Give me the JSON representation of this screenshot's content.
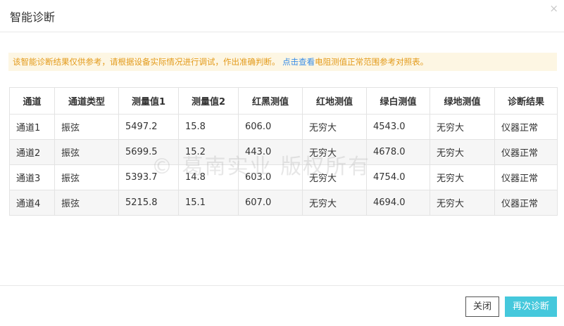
{
  "dialog": {
    "title": "智能诊断",
    "close_glyph": "×"
  },
  "notice": {
    "text": "该智能诊断结果仅供参考，请根据设备实际情况进行调试，作出准确判断。",
    "link_text": "点击查看",
    "link_rest": "电阻测值正常范围参考对照表。"
  },
  "table": {
    "headers": [
      "通道",
      "通道类型",
      "测量值1",
      "测量值2",
      "红黑测值",
      "红地测值",
      "绿白测值",
      "绿地测值",
      "诊断结果"
    ],
    "rows": [
      [
        "通道1",
        "振弦",
        "5497.2",
        "15.8",
        "606.0",
        "无穷大",
        "4543.0",
        "无穷大",
        "仪器正常"
      ],
      [
        "通道2",
        "振弦",
        "5699.5",
        "15.2",
        "443.0",
        "无穷大",
        "4678.0",
        "无穷大",
        "仪器正常"
      ],
      [
        "通道3",
        "振弦",
        "5393.7",
        "14.8",
        "603.0",
        "无穷大",
        "4754.0",
        "无穷大",
        "仪器正常"
      ],
      [
        "通道4",
        "振弦",
        "5215.8",
        "15.1",
        "607.0",
        "无穷大",
        "4694.0",
        "无穷大",
        "仪器正常"
      ]
    ]
  },
  "watermark": "© 葛南实业 版权所有",
  "footer": {
    "close_label": "关闭",
    "retry_label": "再次诊断"
  },
  "colors": {
    "accent": "#45c8dc",
    "notice_text": "#e39a1a",
    "notice_bg": "#fdf6e3",
    "link": "#3a8ee6"
  }
}
